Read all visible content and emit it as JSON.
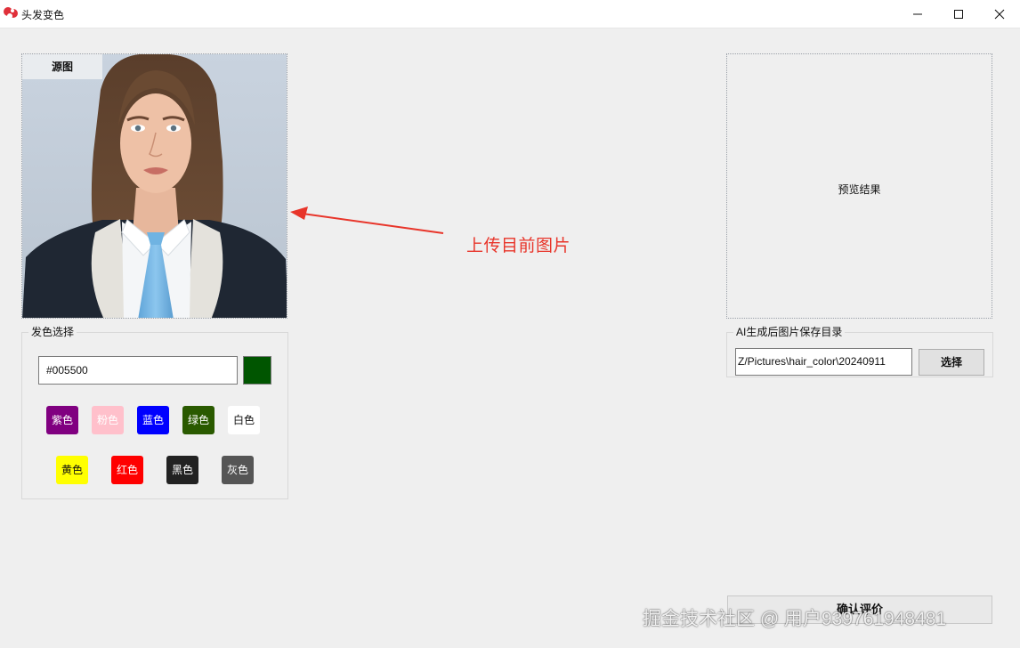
{
  "window": {
    "title": "头发变色"
  },
  "source": {
    "tab_label": "源图"
  },
  "preview": {
    "label": "预览结果"
  },
  "annotation": {
    "text": "上传目前图片"
  },
  "hair": {
    "group_title": "发色选择",
    "hex_value": "#005500",
    "selected_color": "#005500",
    "chips": [
      {
        "label": "紫色",
        "bg": "#800080",
        "fg": "#ffffff"
      },
      {
        "label": "粉色",
        "bg": "#ffc0cb",
        "fg": "#ffffff"
      },
      {
        "label": "蓝色",
        "bg": "#0000ff",
        "fg": "#ffffff"
      },
      {
        "label": "绿色",
        "bg": "#2a5a00",
        "fg": "#ffffff"
      },
      {
        "label": "白色",
        "bg": "#ffffff",
        "fg": "#111111"
      },
      {
        "label": "黄色",
        "bg": "#ffff00",
        "fg": "#111111"
      },
      {
        "label": "红色",
        "bg": "#ff0000",
        "fg": "#ffffff"
      },
      {
        "label": "黑色",
        "bg": "#222222",
        "fg": "#ffffff"
      },
      {
        "label": "灰色",
        "bg": "#555555",
        "fg": "#ffffff"
      }
    ]
  },
  "output": {
    "group_title": "AI生成后图片保存目录",
    "path": "Z/Pictures\\hair_color\\20240911",
    "choose_label": "选择"
  },
  "confirm": {
    "label": "确认评价"
  },
  "watermark": {
    "text": "掘金技术社区 @ 用户939761948481"
  },
  "colors": {
    "annotation": "#e8352a",
    "background": "#efefef"
  }
}
